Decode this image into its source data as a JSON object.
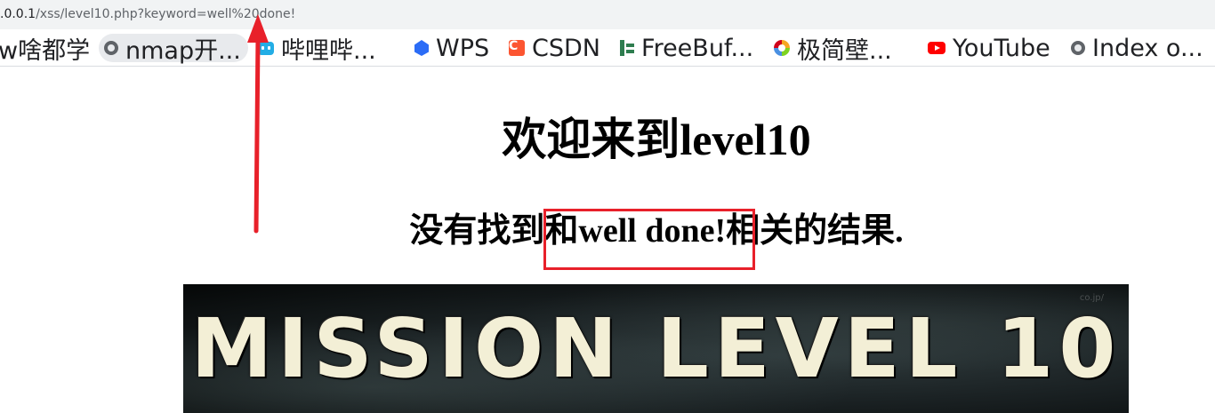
{
  "address_bar": {
    "host": ".0.0.1",
    "path": "/xss/level10.php?keyword=well%20done!"
  },
  "bookmarks": [
    {
      "label": "w啥都学",
      "icon": ""
    },
    {
      "label": "nmap开...",
      "icon": "globe-icon"
    },
    {
      "label": "哔哩哔...",
      "icon": "bilibili-icon"
    },
    {
      "label": "WPS",
      "icon": "wps-icon"
    },
    {
      "label": "CSDN",
      "icon": "csdn-icon",
      "icon_text": "C"
    },
    {
      "label": "FreeBuf...",
      "icon": "freebuf-icon"
    },
    {
      "label": "极简壁...",
      "icon": "jijian-icon"
    },
    {
      "label": "YouTube",
      "icon": "youtube-icon"
    },
    {
      "label": "Index o...",
      "icon": "globe-icon"
    }
  ],
  "page": {
    "heading": "欢迎来到level10",
    "result_prefix": "没有找到和",
    "result_keyword": "well done!",
    "result_suffix": "相关的结果.",
    "banner": {
      "title": "MISSION LEVEL 10",
      "watermark": "co.jp/"
    }
  },
  "annotation": {
    "color": "#e8202a"
  }
}
